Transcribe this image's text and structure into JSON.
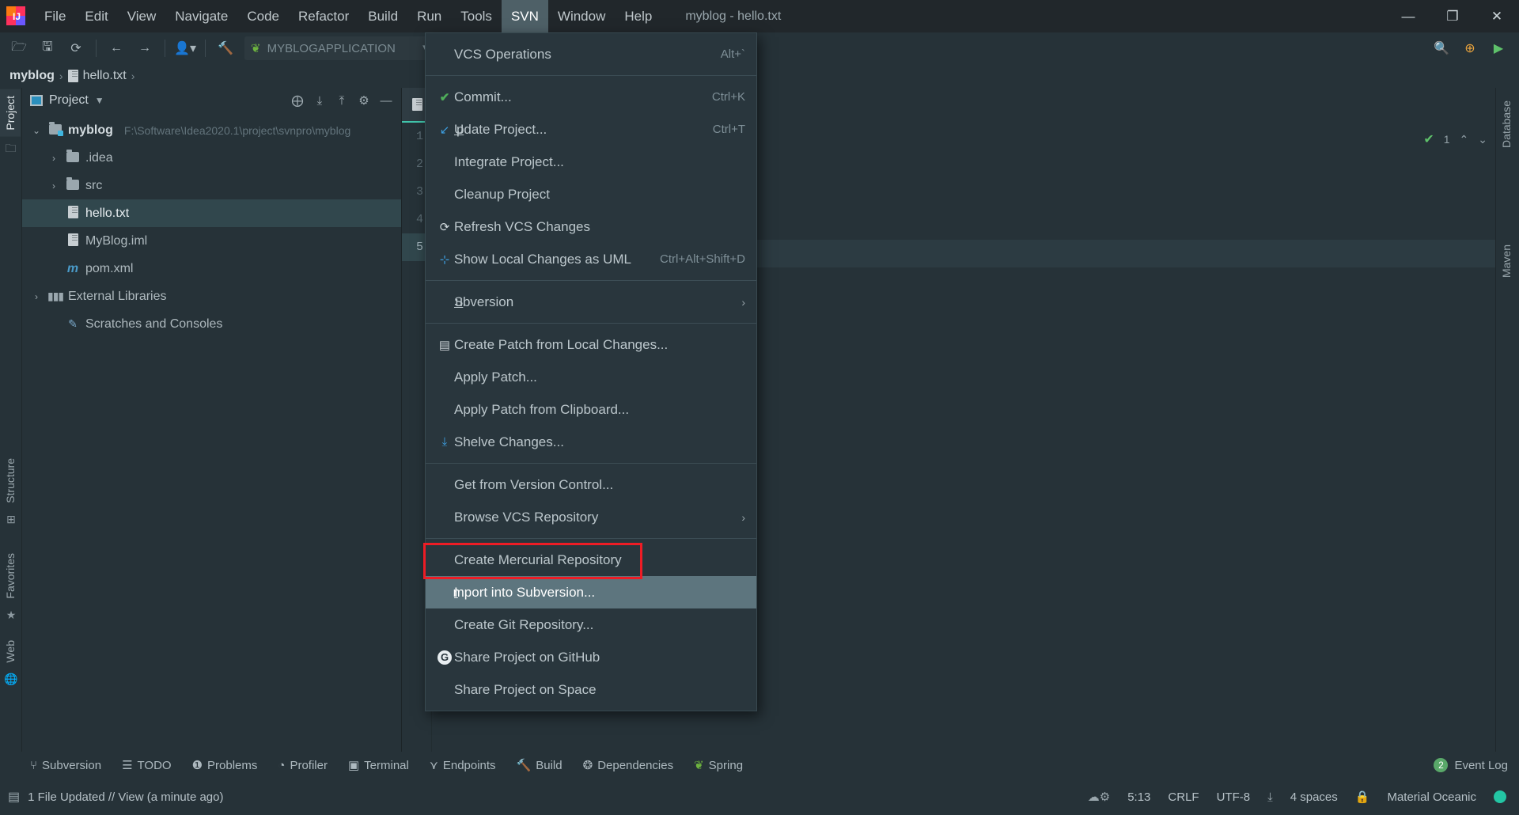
{
  "window": {
    "title": "myblog - hello.txt",
    "minimize": "—",
    "maximize": "❐",
    "close": "✕"
  },
  "menubar": {
    "items": [
      {
        "label": "File",
        "accel": "F"
      },
      {
        "label": "Edit",
        "accel": "E"
      },
      {
        "label": "View",
        "accel": "V"
      },
      {
        "label": "Navigate",
        "accel": "N"
      },
      {
        "label": "Code",
        "accel": "C"
      },
      {
        "label": "Refactor",
        "accel": "R"
      },
      {
        "label": "Build",
        "accel": "B"
      },
      {
        "label": "Run",
        "accel": "u"
      },
      {
        "label": "Tools",
        "accel": "T"
      },
      {
        "label": "SVN",
        "accel": "S",
        "active": true
      },
      {
        "label": "Window",
        "accel": "W"
      },
      {
        "label": "Help",
        "accel": "H"
      }
    ]
  },
  "toolbar": {
    "run_config": "MYBLOGAPPLICATION",
    "dropdown_caret": "▼",
    "icons": [
      "open-folder-icon",
      "save-icon",
      "sync-icon",
      "back-arrow-icon",
      "forward-arrow-icon",
      "profile-icon",
      "build-hammer-icon"
    ],
    "right_icons": [
      "search-icon",
      "update-badge-icon",
      "run-icon"
    ]
  },
  "breadcrumb": {
    "project": "myblog",
    "file": "hello.txt",
    "separator": "›"
  },
  "project_panel": {
    "title": "Project",
    "caret": "▼",
    "header_icons": [
      "locate-icon",
      "expand-all-icon",
      "collapse-all-icon",
      "settings-gear-icon",
      "hide-panel-icon"
    ],
    "tree": [
      {
        "label": "myblog",
        "path": "F:\\Software\\Idea2020.1\\project\\svnpro\\myblog",
        "arrow": "⌄",
        "icon": "module-folder-icon",
        "depth": 0,
        "bold": true
      },
      {
        "label": ".idea",
        "arrow": "›",
        "icon": "folder-icon",
        "depth": 1
      },
      {
        "label": "src",
        "arrow": "›",
        "icon": "folder-icon",
        "depth": 1
      },
      {
        "label": "hello.txt",
        "arrow": "",
        "icon": "text-file-icon",
        "depth": 2,
        "selected": true
      },
      {
        "label": "MyBlog.iml",
        "arrow": "",
        "icon": "iml-file-icon",
        "depth": 2
      },
      {
        "label": "pom.xml",
        "arrow": "",
        "icon": "maven-file-icon",
        "depth": 2
      },
      {
        "label": "External Libraries",
        "arrow": "›",
        "icon": "libraries-icon",
        "depth": 0
      },
      {
        "label": "Scratches and Consoles",
        "arrow": "",
        "icon": "scratches-icon",
        "depth": 0
      }
    ]
  },
  "left_strip": {
    "tabs": [
      "Project",
      "Structure",
      "Favorites",
      "Web"
    ]
  },
  "right_strip": {
    "tabs": [
      "Database",
      "Maven"
    ]
  },
  "editor": {
    "line_numbers": [
      "1",
      "2",
      "3",
      "4",
      "5"
    ],
    "current_line": "5",
    "inspection_count": "1",
    "up_arrow": "⌃",
    "down_arrow": "⌄"
  },
  "svn_menu": {
    "items": [
      {
        "label": "VCS Operations",
        "shortcut": "Alt+`",
        "icon": "",
        "accel": ""
      },
      {
        "sep": true
      },
      {
        "label": "Commit...",
        "shortcut": "Ctrl+K",
        "icon": "check-green-icon",
        "accel": "i"
      },
      {
        "label": "Update Project...",
        "shortcut": "Ctrl+T",
        "icon": "update-arrow-icon",
        "accel": "U"
      },
      {
        "label": "Integrate Project...",
        "shortcut": "",
        "icon": ""
      },
      {
        "label": "Cleanup Project",
        "shortcut": "",
        "icon": ""
      },
      {
        "label": "Refresh VCS Changes",
        "shortcut": "",
        "icon": "refresh-icon"
      },
      {
        "label": "Show Local Changes as UML",
        "shortcut": "Ctrl+Alt+Shift+D",
        "icon": "uml-icon"
      },
      {
        "sep": true
      },
      {
        "label": "Subversion",
        "shortcut": "",
        "icon": "",
        "submenu": "›",
        "accel": "S"
      },
      {
        "sep": true
      },
      {
        "label": "Create Patch from Local Changes...",
        "shortcut": "",
        "icon": "patch-icon"
      },
      {
        "label": "Apply Patch...",
        "shortcut": "",
        "icon": ""
      },
      {
        "label": "Apply Patch from Clipboard...",
        "shortcut": "",
        "icon": ""
      },
      {
        "label": "Shelve Changes...",
        "shortcut": "",
        "icon": "shelve-icon"
      },
      {
        "sep": true
      },
      {
        "label": "Get from Version Control...",
        "shortcut": "",
        "icon": ""
      },
      {
        "label": "Browse VCS Repository",
        "shortcut": "",
        "icon": "",
        "submenu": "›"
      },
      {
        "sep": true
      },
      {
        "label": "Create Mercurial Repository",
        "shortcut": "",
        "icon": ""
      },
      {
        "label": "Import into Subversion...",
        "shortcut": "",
        "icon": "",
        "highlight": true,
        "accel": "I"
      },
      {
        "label": "Create Git Repository...",
        "shortcut": "",
        "icon": ""
      },
      {
        "label": "Share Project on GitHub",
        "shortcut": "",
        "icon": "github-icon"
      },
      {
        "label": "Share Project on Space",
        "shortcut": "",
        "icon": ""
      }
    ]
  },
  "bottom_tabs": [
    {
      "label": "Subversion",
      "icon": "branch-icon"
    },
    {
      "label": "TODO",
      "icon": "list-icon"
    },
    {
      "label": "Problems",
      "icon": "error-icon"
    },
    {
      "label": "Profiler",
      "icon": "profiler-icon"
    },
    {
      "label": "Terminal",
      "icon": "terminal-icon"
    },
    {
      "label": "Endpoints",
      "icon": "endpoints-icon"
    },
    {
      "label": "Build",
      "icon": "build-icon"
    },
    {
      "label": "Dependencies",
      "icon": "dependencies-icon"
    },
    {
      "label": "Spring",
      "icon": "spring-leaf-icon"
    }
  ],
  "event_log": {
    "label": "Event Log",
    "count": "2"
  },
  "statusbar": {
    "message": "1 File Updated // View (a minute ago)",
    "caret_position": "5:13",
    "line_separator": "CRLF",
    "encoding": "UTF-8",
    "indent": "4 spaces",
    "theme": "Material Oceanic",
    "accent_color": "#23c6a4"
  }
}
